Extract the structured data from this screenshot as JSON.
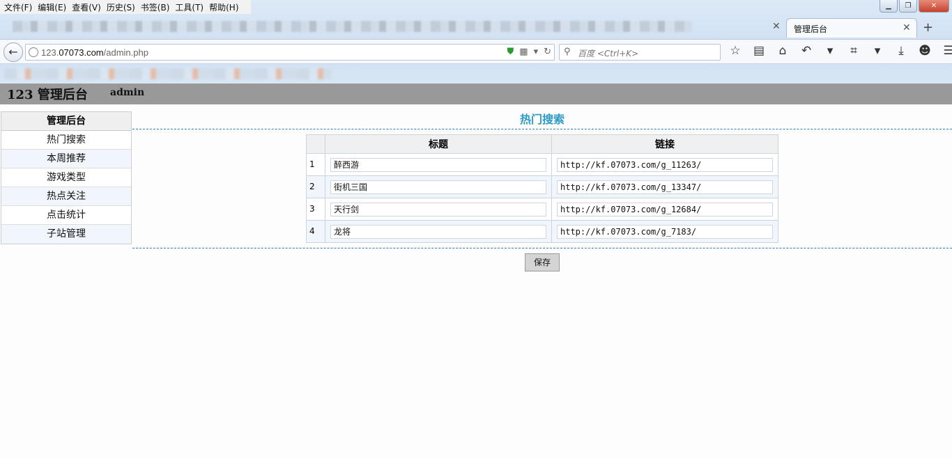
{
  "menubar": [
    "文件(F)",
    "编辑(E)",
    "查看(V)",
    "历史(S)",
    "书签(B)",
    "工具(T)",
    "帮助(H)"
  ],
  "tab": {
    "title": "管理后台"
  },
  "url": {
    "host_pre": "123.",
    "host_bold": "07073.com",
    "path": "/admin.php"
  },
  "search": {
    "placeholder": "百度 <Ctrl+K>"
  },
  "header": {
    "title": "123 管理后台",
    "user": "admin"
  },
  "sidebar": {
    "heading": "管理后台",
    "items": [
      {
        "label": "热门搜索"
      },
      {
        "label": "本周推荐"
      },
      {
        "label": "游戏类型"
      },
      {
        "label": "热点关注"
      },
      {
        "label": "点击统计"
      },
      {
        "label": "子站管理"
      }
    ]
  },
  "main": {
    "title": "热门搜索",
    "columns": [
      "标题",
      "链接"
    ],
    "rows": [
      {
        "num": "1",
        "title": "醉西游",
        "link": "http://kf.07073.com/g_11263/"
      },
      {
        "num": "2",
        "title": "街机三国",
        "link": "http://kf.07073.com/g_13347/"
      },
      {
        "num": "3",
        "title": "天行剑",
        "link": "http://kf.07073.com/g_12684/"
      },
      {
        "num": "4",
        "title": "龙将",
        "link": "http://kf.07073.com/g_7183/"
      }
    ],
    "save_label": "保存"
  },
  "colors": {
    "accent": "#2a9bc9",
    "header_bg": "#999999"
  }
}
